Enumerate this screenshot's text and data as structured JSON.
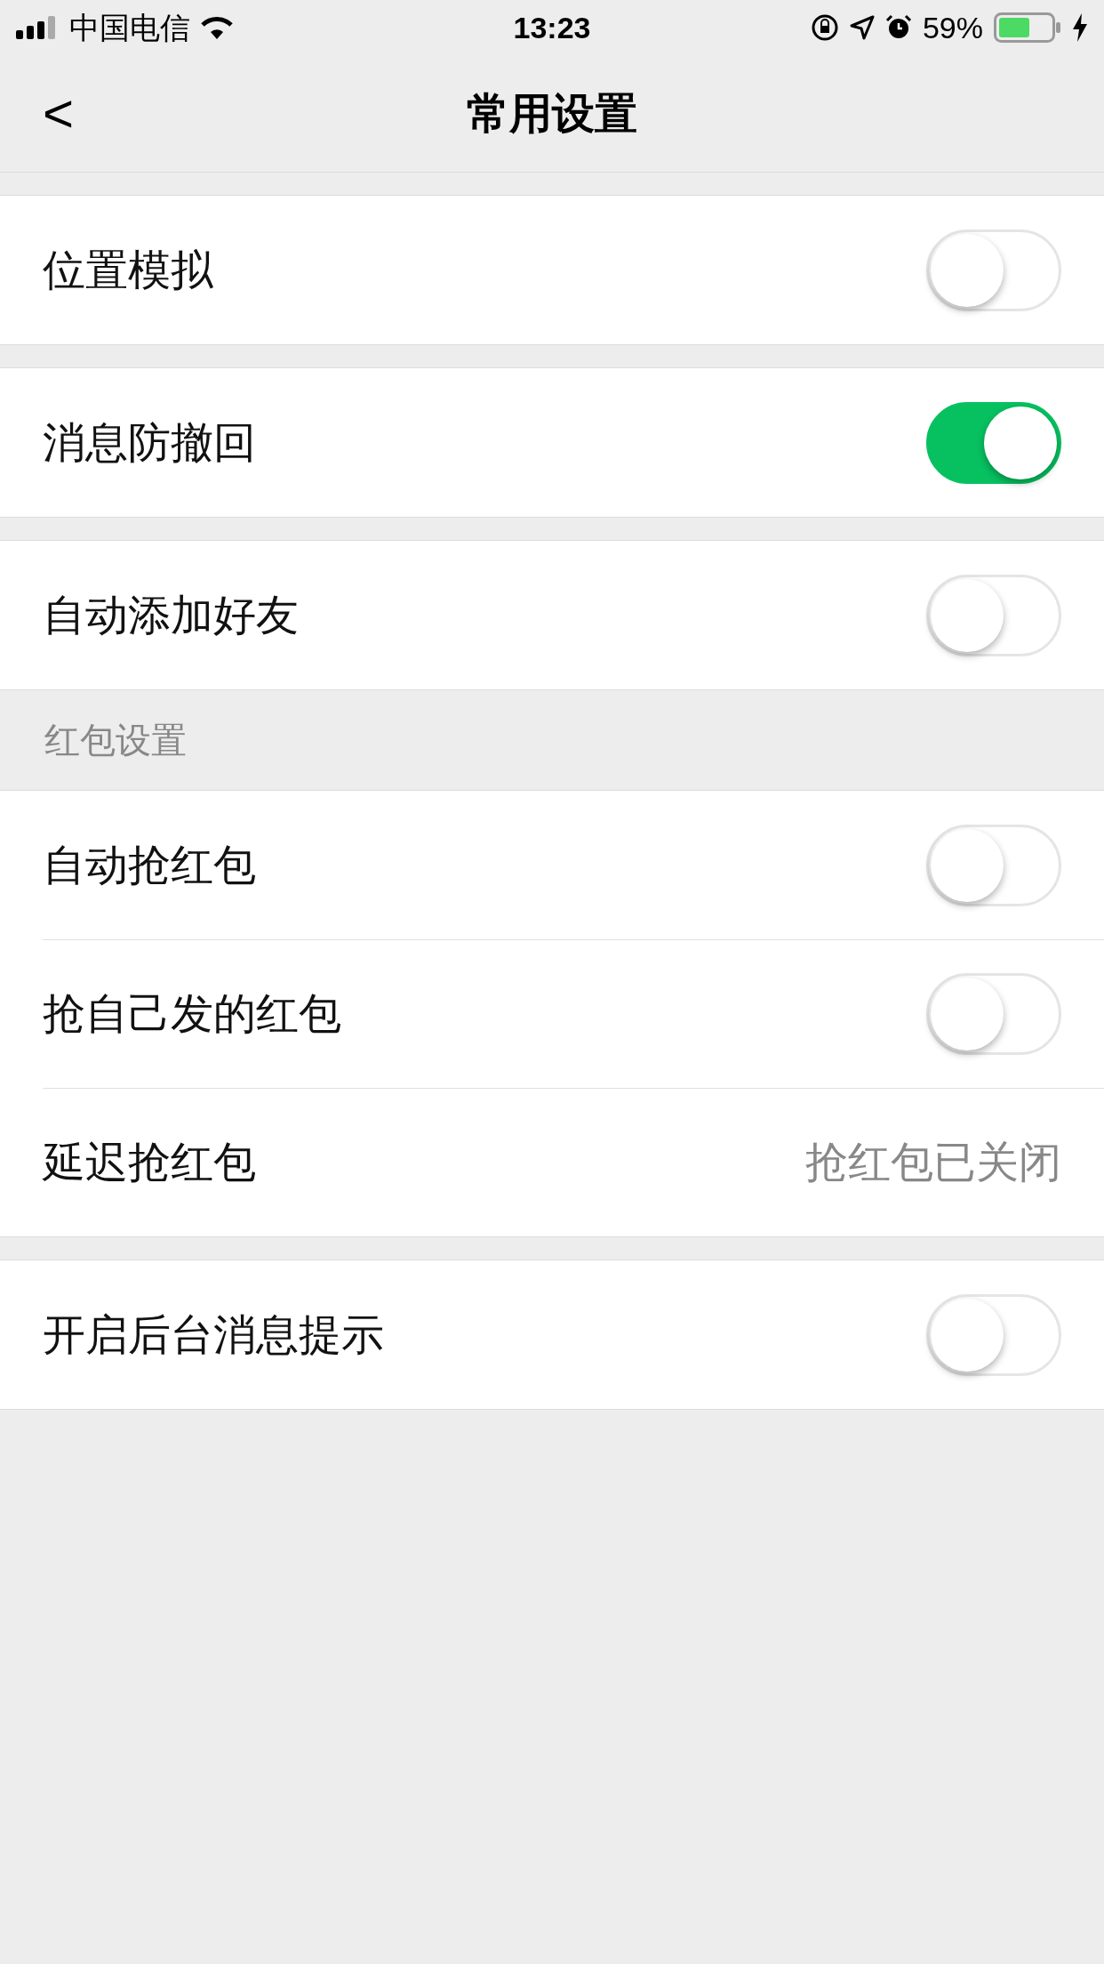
{
  "status_bar": {
    "carrier": "中国电信",
    "time": "13:23",
    "battery": "59%"
  },
  "nav": {
    "back": "<",
    "title": "常用设置"
  },
  "groups": [
    {
      "rows": [
        {
          "kind": "toggle",
          "label": "位置模拟",
          "on": false
        }
      ]
    },
    {
      "rows": [
        {
          "kind": "toggle",
          "label": "消息防撤回",
          "on": true
        }
      ]
    },
    {
      "rows": [
        {
          "kind": "toggle",
          "label": "自动添加好友",
          "on": false
        }
      ]
    },
    {
      "header": "红包设置",
      "rows": [
        {
          "kind": "toggle",
          "label": "自动抢红包",
          "on": false
        },
        {
          "kind": "toggle",
          "label": "抢自己发的红包",
          "on": false
        },
        {
          "kind": "value",
          "label": "延迟抢红包",
          "value": "抢红包已关闭"
        }
      ]
    },
    {
      "rows": [
        {
          "kind": "toggle",
          "label": "开启后台消息提示",
          "on": false
        }
      ]
    }
  ]
}
